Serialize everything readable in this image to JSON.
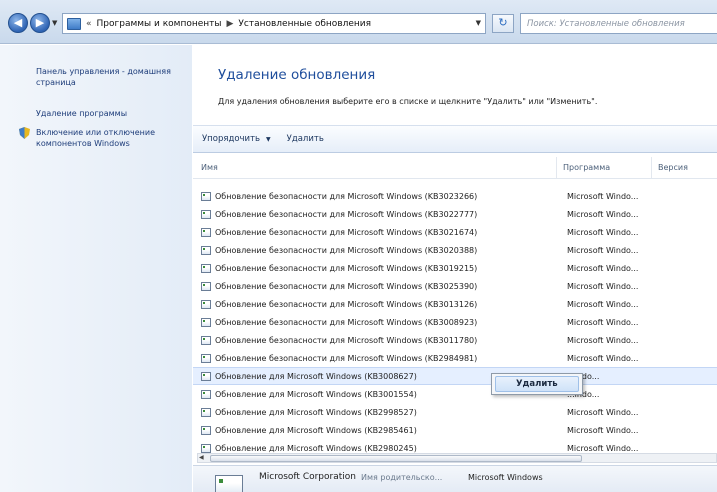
{
  "address_bar": {
    "crumb_prefix": "«",
    "crumbs": [
      "Программы и компоненты",
      "Установленные обновления"
    ],
    "search_placeholder": "Поиск: Установленные обновления"
  },
  "left_pane": {
    "links": [
      "Панель управления - домашняя страница",
      "Удаление программы",
      "Включение или отключение компонентов Windows"
    ]
  },
  "main": {
    "title": "Удаление обновления",
    "subtitle": "Для удаления обновления выберите его в списке и щелкните \"Удалить\" или \"Изменить\".",
    "toolbar": {
      "organize": "Упорядочить",
      "uninstall": "Удалить"
    },
    "columns": {
      "name": "Имя",
      "program": "Программа",
      "version": "Версия"
    },
    "rows": [
      {
        "name": "Обновление безопасности для Microsoft Windows (KB3023266)",
        "program": "Microsoft Windo..."
      },
      {
        "name": "Обновление безопасности для Microsoft Windows (KB3022777)",
        "program": "Microsoft Windo..."
      },
      {
        "name": "Обновление безопасности для Microsoft Windows (KB3021674)",
        "program": "Microsoft Windo..."
      },
      {
        "name": "Обновление безопасности для Microsoft Windows (KB3020388)",
        "program": "Microsoft Windo..."
      },
      {
        "name": "Обновление безопасности для Microsoft Windows (KB3019215)",
        "program": "Microsoft Windo..."
      },
      {
        "name": "Обновление безопасности для Microsoft Windows (KB3025390)",
        "program": "Microsoft Windo..."
      },
      {
        "name": "Обновление безопасности для Microsoft Windows (KB3013126)",
        "program": "Microsoft Windo..."
      },
      {
        "name": "Обновление безопасности для Microsoft Windows (KB3008923)",
        "program": "Microsoft Windo..."
      },
      {
        "name": "Обновление безопасности для Microsoft Windows (KB3011780)",
        "program": "Microsoft Windo..."
      },
      {
        "name": "Обновление безопасности для Microsoft Windows (KB2984981)",
        "program": "Microsoft Windo..."
      },
      {
        "name": "Обновление для Microsoft Windows (KB3008627)",
        "program": "...indo..."
      },
      {
        "name": "Обновление для Microsoft Windows (KB3001554)",
        "program": "...indo..."
      },
      {
        "name": "Обновление для Microsoft Windows (KB2998527)",
        "program": "Microsoft Windo..."
      },
      {
        "name": "Обновление для Microsoft Windows (KB2985461)",
        "program": "Microsoft Windo..."
      },
      {
        "name": "Обновление для Microsoft Windows (KB2980245)",
        "program": "Microsoft Windo..."
      }
    ],
    "selected_row_index": 10
  },
  "context_menu": {
    "uninstall": "Удалить"
  },
  "details": {
    "company": "Microsoft Corporation",
    "parent_label": "Имя родительско...",
    "parent_value": "Microsoft Windows"
  },
  "colors": {
    "title": "#1f4e9c",
    "link": "#1e3d7a",
    "selection": "#e5efff"
  }
}
